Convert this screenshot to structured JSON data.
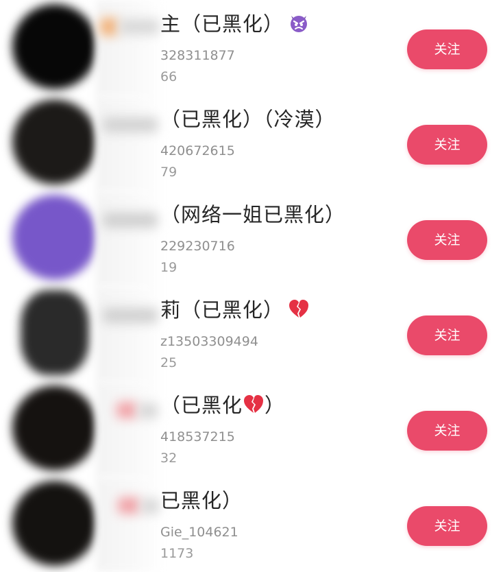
{
  "users": [
    {
      "name": "主（已黑化）",
      "uid": "328311877",
      "fans": "66",
      "button_label": "关注",
      "avatar_color": "#070707"
    },
    {
      "name": "（已黑化）（冷漠）",
      "uid": "420672615",
      "fans": "79",
      "button_label": "关注",
      "avatar_color": "#1c1a18"
    },
    {
      "name": "（网络一姐已黑化）",
      "uid": "229230716",
      "fans": "19",
      "button_label": "关注",
      "avatar_color": "#7757c9"
    },
    {
      "name": "莉（已黑化）",
      "uid": "z13503309494",
      "fans": "25",
      "button_label": "关注",
      "avatar_color": "#2a2a2a"
    },
    {
      "name": "（已黑化",
      "name_suffix": "）",
      "uid": "418537215",
      "fans": "32",
      "button_label": "关注",
      "avatar_color": "#151210"
    },
    {
      "name": "已黑化）",
      "uid": "Gie_104621",
      "fans": "1173",
      "button_label": "关注",
      "avatar_color": "#141210"
    }
  ],
  "colors": {
    "follow_button": "#ea4a6a",
    "name_text": "#262626",
    "meta_text": "#8f8f8f"
  },
  "icons": [
    "angry-devil-emoji-icon",
    "broken-heart-emoji-icon"
  ]
}
